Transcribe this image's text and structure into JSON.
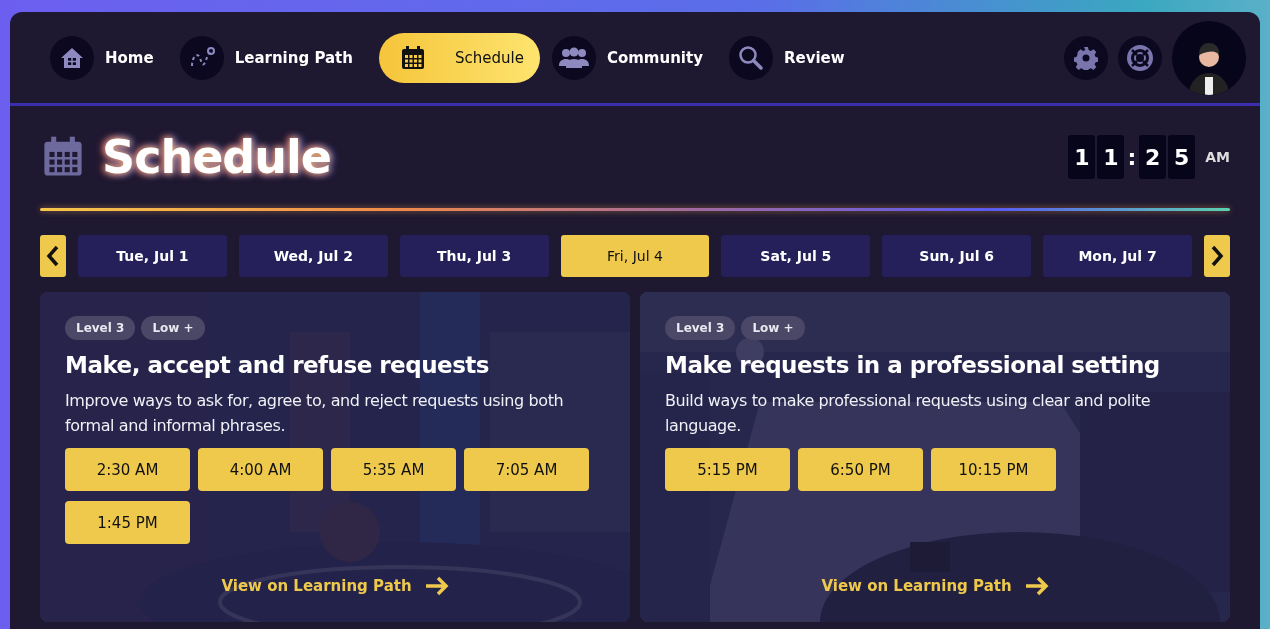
{
  "nav": {
    "tabs": [
      {
        "label": "Home",
        "kind": "home",
        "selected": false
      },
      {
        "label": "Learning Path",
        "kind": "path",
        "selected": false
      },
      {
        "label": "Schedule",
        "kind": "calendar",
        "selected": true
      },
      {
        "label": "Community",
        "kind": "people",
        "selected": false
      },
      {
        "label": "Review",
        "kind": "magnifier",
        "selected": false
      }
    ]
  },
  "header": {
    "title": "Schedule",
    "clock": {
      "digits": [
        "1",
        "1",
        ":",
        "2",
        "5"
      ],
      "period": "AM"
    }
  },
  "days": [
    {
      "label": "Tue, Jul 1",
      "selected": false
    },
    {
      "label": "Wed, Jul 2",
      "selected": false
    },
    {
      "label": "Thu, Jul 3",
      "selected": false
    },
    {
      "label": "Fri, Jul 4",
      "selected": true
    },
    {
      "label": "Sat, Jul 5",
      "selected": false
    },
    {
      "label": "Sun, Jul 6",
      "selected": false
    },
    {
      "label": "Mon, Jul 7",
      "selected": false
    }
  ],
  "lessons": [
    {
      "tags": [
        "Level 3",
        "Low +"
      ],
      "title": "Make, accept and refuse requests",
      "description": "Improve ways to ask for, agree to, and reject requests using both formal and informal phrases.",
      "times": [
        "2:30 AM",
        "4:00 AM",
        "5:35 AM",
        "7:05 AM",
        "1:45 PM"
      ],
      "link": "View on Learning Path",
      "kind": "hall"
    },
    {
      "tags": [
        "Level 3",
        "Low +"
      ],
      "title": "Make requests in a professional setting",
      "description": "Build ways to make professional requests using clear and polite language.",
      "times": [
        "5:15 PM",
        "6:50 PM",
        "10:15 PM"
      ],
      "link": "View on Learning Path",
      "kind": "office"
    }
  ]
}
